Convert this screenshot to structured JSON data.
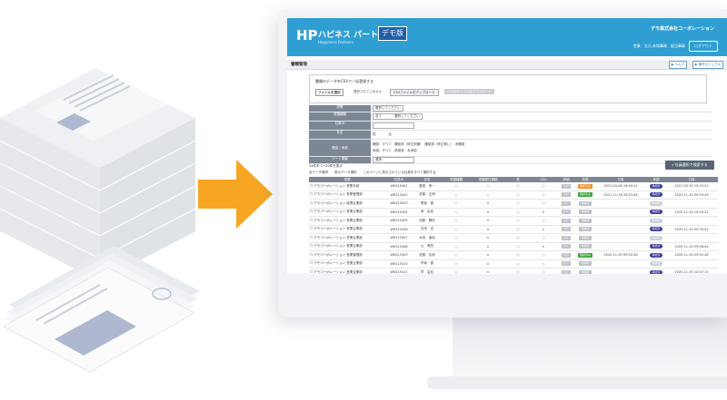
{
  "app": {
    "logo_mark": "HP",
    "logo_text": "ハピネス パートナーズ",
    "logo_sub": "Happiness Partners",
    "demo_badge": "デモ版",
    "company": "デモ株式会社コーポレーション",
    "user_info": "営業　太元 未知事務　配当事務",
    "logout": "ログアウト"
  },
  "page": {
    "title": "書類管理",
    "btn1": "▶ ヘルプ",
    "btn2": "▶ 操作マニュアル"
  },
  "upload": {
    "title": "書類のデータをCSVで一括登録する",
    "file_button": "ファイルを選択",
    "file_none": "選択されていません",
    "upload_button": "CSVファイルをアップロード",
    "template_button": "CSVのサンプルをダウンロード"
  },
  "form": {
    "rows": [
      {
        "label": "部署",
        "value": "選択してください"
      },
      {
        "label": "書類種類",
        "value": "全て　　　　選択してください"
      },
      {
        "label": "社員ID",
        "value": ""
      },
      {
        "label": "氏名",
        "value": "姓　　　　名"
      },
      {
        "label": "確認 / 承認",
        "value": "確認：すべて　確認済（修正依頼）　確認済（修正無し）　未確認"
      },
      {
        "label": "ソート順番",
        "value": "選択"
      }
    ],
    "approve_line": "承認：すべて　承認済　未承認"
  },
  "list": {
    "count": "24件中 1〜20件を表示",
    "select_all": "全データ選択　　表示データ選択　　このページに表示されている社員をすべて選択する",
    "search_button": "社員選択で検索する"
  },
  "table": {
    "headers": [
      "書類",
      "社員ID",
      "氏名",
      "書類種類",
      "書類受付情報",
      "受",
      "CSV",
      "詳細",
      "状態",
      "日時",
      "承認",
      "日時"
    ],
    "rows": [
      {
        "doc": "☐ デモコーポレーション 営業本部",
        "id": "WKS15401",
        "name": "藤田　孝一",
        "s1": "○",
        "s2": "○",
        "s3": "○",
        "s4": "○",
        "status": {
          "label": "確認済み",
          "color": "orange"
        },
        "d1": "2021-04-08 16:09:41",
        "ap": {
          "label": "承認済",
          "color": "navy"
        },
        "d2": "2021-03-30 19:32:07"
      },
      {
        "doc": "☐ デモコーポレーション 営業管理部",
        "id": "WKS15402",
        "name": "佐藤　正明",
        "s1": "○",
        "s2": "○",
        "s3": "○",
        "s4": "○",
        "status": {
          "label": "確認済み",
          "color": "green"
        },
        "d1": "2021-11-26 09:53:48",
        "ap": {
          "label": "承認済",
          "color": "navy"
        },
        "d2": "2020-11-30 09:53:49"
      },
      {
        "doc": "☐ デモコーポレーション 経理企業部",
        "id": "WKS15403",
        "name": "野坂　優",
        "s1": "○",
        "s2": "×",
        "s3": "○",
        "s4": "○",
        "status": {
          "label": "未確認",
          "color": "gray"
        },
        "d1": "",
        "ap": {
          "label": "未承認",
          "color": "soft"
        },
        "d2": ""
      },
      {
        "doc": "☐ デモコーポレーション 営業企業部",
        "id": "WKS15404",
        "name": "茅　由佳",
        "s1": "○",
        "s2": "×",
        "s3": "○",
        "s4": "×",
        "status": {
          "label": "未確認",
          "color": "gray"
        },
        "d1": "",
        "ap": {
          "label": "承認済",
          "color": "navy"
        },
        "d2": "2020-11-30 10:05:22"
      },
      {
        "doc": "☐ デモコーポレーション 営業企業部",
        "id": "WKS15405",
        "name": "加藤　陽好",
        "s1": "○",
        "s2": "×",
        "s3": "○",
        "s4": "○",
        "status": {
          "label": "未確認",
          "color": "gray"
        },
        "d1": "",
        "ap": {
          "label": "未承認",
          "color": "soft"
        },
        "d2": ""
      },
      {
        "doc": "☐ デモコーポレーション 営業企業部",
        "id": "WKS15406",
        "name": "石田　杏",
        "s1": "○",
        "s2": "×",
        "s3": "○",
        "s4": "×",
        "status": {
          "label": "未確認",
          "color": "gray"
        },
        "d1": "",
        "ap": {
          "label": "承認済",
          "color": "navy"
        },
        "d2": "2020-11-30 09:35:01"
      },
      {
        "doc": "☐ デモコーポレーション 営業企業部",
        "id": "WKS15407",
        "name": "木島　亜紀",
        "s1": "○",
        "s2": "×",
        "s3": "○",
        "s4": "○",
        "status": {
          "label": "未確認",
          "color": "gray"
        },
        "d1": "",
        "ap": {
          "label": "未承認",
          "color": "soft"
        },
        "d2": ""
      },
      {
        "doc": "☐ デモコーポレーション 営業企業部",
        "id": "WKS15408",
        "name": "山　美四",
        "s1": "○",
        "s2": "×",
        "s3": "○",
        "s4": "×",
        "status": {
          "label": "未確認",
          "color": "gray"
        },
        "d1": "",
        "ap": {
          "label": "承認済",
          "color": "navy"
        },
        "d2": "2020-11-30 09:56:44"
      },
      {
        "doc": "☐ デモコーポレーション 営業管理部",
        "id": "WKS15409",
        "name": "佐藤　友彦",
        "s1": "○",
        "s2": "×",
        "s3": "○",
        "s4": "○",
        "status": {
          "label": "確認済み",
          "color": "green"
        },
        "d1": "2020-11-30 09:52:46",
        "ap": {
          "label": "承認済",
          "color": "navy"
        },
        "d2": "2020-11-30 09:52:48"
      },
      {
        "doc": "☐ デモコーポレーション 営業企業部",
        "id": "WKS15410",
        "name": "早坂　優",
        "s1": "○",
        "s2": "×",
        "s3": "○",
        "s4": "○",
        "status": {
          "label": "未確認",
          "color": "gray"
        },
        "d1": "",
        "ap": {
          "label": "未承認",
          "color": "soft"
        },
        "d2": ""
      },
      {
        "doc": "☐ デモコーポレーション 営業企業部",
        "id": "WKS15411",
        "name": "早　由佳",
        "s1": "○",
        "s2": "×",
        "s3": "○",
        "s4": "○",
        "status": {
          "label": "未確認",
          "color": "gray"
        },
        "d1": "",
        "ap": {
          "label": "承認済",
          "color": "navy"
        },
        "d2": "2020-11-30 10:07:10"
      },
      {
        "doc": "☐ デモコーポレーション 営業企業部",
        "id": "WKS15412",
        "name": "加藤　陽好",
        "s1": "○",
        "s2": "×",
        "s3": "○",
        "s4": "×",
        "status": {
          "label": "未確認",
          "color": "gray"
        },
        "d1": "",
        "ap": {
          "label": "未承認",
          "color": "soft"
        },
        "d2": ""
      }
    ],
    "detail_label": "表示"
  },
  "colors": {
    "topbar": "#2f9fd3",
    "orange": "#f08a1c",
    "arrow": "#f6a623",
    "green": "#3aa535",
    "navy": "#3a3d9c"
  }
}
